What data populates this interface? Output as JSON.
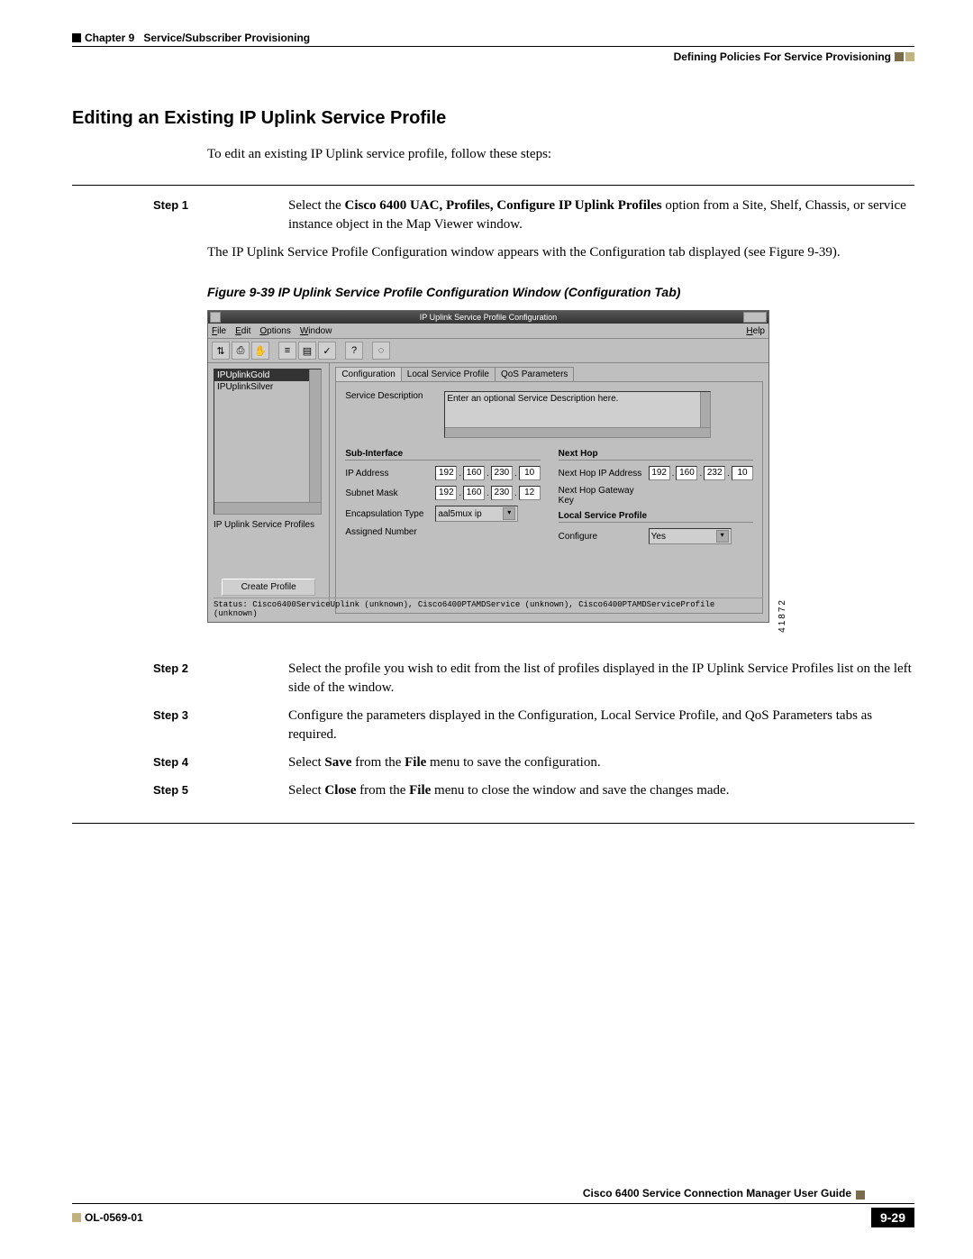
{
  "header": {
    "chapter": "Chapter 9",
    "chapter_title": "Service/Subscriber Provisioning",
    "subhead": "Defining Policies For Service Provisioning"
  },
  "section_heading": "Editing an Existing IP Uplink Service Profile",
  "intro": "To edit an existing IP Uplink service profile, follow these steps:",
  "step1": {
    "label": "Step 1",
    "pre": "Select the ",
    "bold": "Cisco 6400 UAC, Profiles, Configure IP Uplink Profiles",
    "post": " option from a Site, Shelf, Chassis, or service instance object in the Map Viewer window."
  },
  "after_step1_para": "The IP Uplink Service Profile Configuration window appears with the Configuration tab displayed (see Figure 9-39).",
  "figure_caption": "Figure 9-39   IP Uplink Service Profile Configuration Window (Configuration Tab)",
  "figure_side_id": "41872",
  "app": {
    "title": "IP Uplink Service Profile Configuration",
    "menus": {
      "file": "File",
      "edit": "Edit",
      "options": "Options",
      "window": "Window",
      "help": "Help"
    },
    "list": {
      "sel": "IPUplinkGold",
      "item2": "IPUplinkSilver"
    },
    "left_label": "IP Uplink Service Profiles",
    "create_btn": "Create Profile",
    "tabs": {
      "t1": "Configuration",
      "t2": "Local Service Profile",
      "t3": "QoS Parameters"
    },
    "desc_label": "Service Description",
    "desc_value": "Enter an optional Service Description here.",
    "sub_if_title": "Sub-Interface",
    "nexthop_title": "Next Hop",
    "ip_label": "IP Address",
    "subnet_label": "Subnet Mask",
    "encap_label": "Encapsulation Type",
    "assigned_label": "Assigned Number",
    "nh_ip_label": "Next Hop IP Address",
    "nh_key_label": "Next Hop Gateway Key",
    "lsp_title": "Local Service Profile",
    "configure_label": "Configure",
    "encap_value": "aal5mux ip",
    "configure_value": "Yes",
    "ip1": {
      "a": "192",
      "b": "160",
      "c": "230",
      "d": "10"
    },
    "subnet": {
      "a": "192",
      "b": "160",
      "c": "230",
      "d": "12"
    },
    "nhip": {
      "a": "192",
      "b": "160",
      "c": "232",
      "d": "10"
    },
    "status": "Status: Cisco6400ServiceUplink (unknown), Cisco6400PTAMDService (unknown), Cisco6400PTAMDServiceProfile (unknown)"
  },
  "step2": {
    "label": "Step 2",
    "text": "Select the profile you wish to edit from the list of profiles displayed in the IP Uplink Service Profiles list on the left side of the window."
  },
  "step3": {
    "label": "Step 3",
    "text": "Configure the parameters displayed in the Configuration, Local Service Profile, and QoS Parameters tabs as required."
  },
  "step4": {
    "label": "Step 4",
    "pre": "Select ",
    "b1": "Save",
    "mid": " from the ",
    "b2": "File",
    "post": " menu to save the configuration."
  },
  "step5": {
    "label": "Step 5",
    "pre": "Select ",
    "b1": "Close",
    "mid": " from the ",
    "b2": "File",
    "post": " menu to close the window and save the changes made."
  },
  "footer": {
    "guide": "Cisco 6400 Service Connection Manager User Guide",
    "ol": "OL-0569-01",
    "page": "9-29"
  }
}
